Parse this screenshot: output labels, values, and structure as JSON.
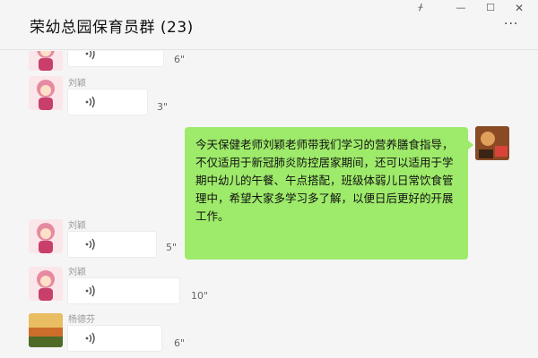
{
  "window": {
    "title": "荣幼总园保育员群 (23)",
    "controls": {
      "pin": "ᚋ",
      "minimize": "—",
      "maximize": "☐",
      "close": "✕"
    },
    "more": "···"
  },
  "messages": [
    {
      "sender": "",
      "duration": "6\"",
      "avatar": "girl-avatar"
    },
    {
      "sender": "刘颖",
      "duration": "3\"",
      "avatar": "girl-avatar"
    },
    {
      "sender": "",
      "text": "今天保健老师刘颖老师带我们学习的营养膳食指导，不仅适用于新冠肺炎防控居家期间，还可以适用于学期中幼儿的午餐、午点搭配，班级体弱儿日常饮食管理中，希望大家多学习多了解，以便日后更好的开展工作。"
    },
    {
      "sender": "刘颖",
      "duration": "5\"",
      "avatar": "girl-avatar"
    },
    {
      "sender": "刘颖",
      "duration": "10\"",
      "avatar": "girl-avatar"
    },
    {
      "sender": "杨德芬",
      "duration": "6\"",
      "avatar": "landscape-avatar"
    }
  ],
  "colors": {
    "self_bubble": "#9eea6a",
    "background": "#f5f5f5"
  }
}
